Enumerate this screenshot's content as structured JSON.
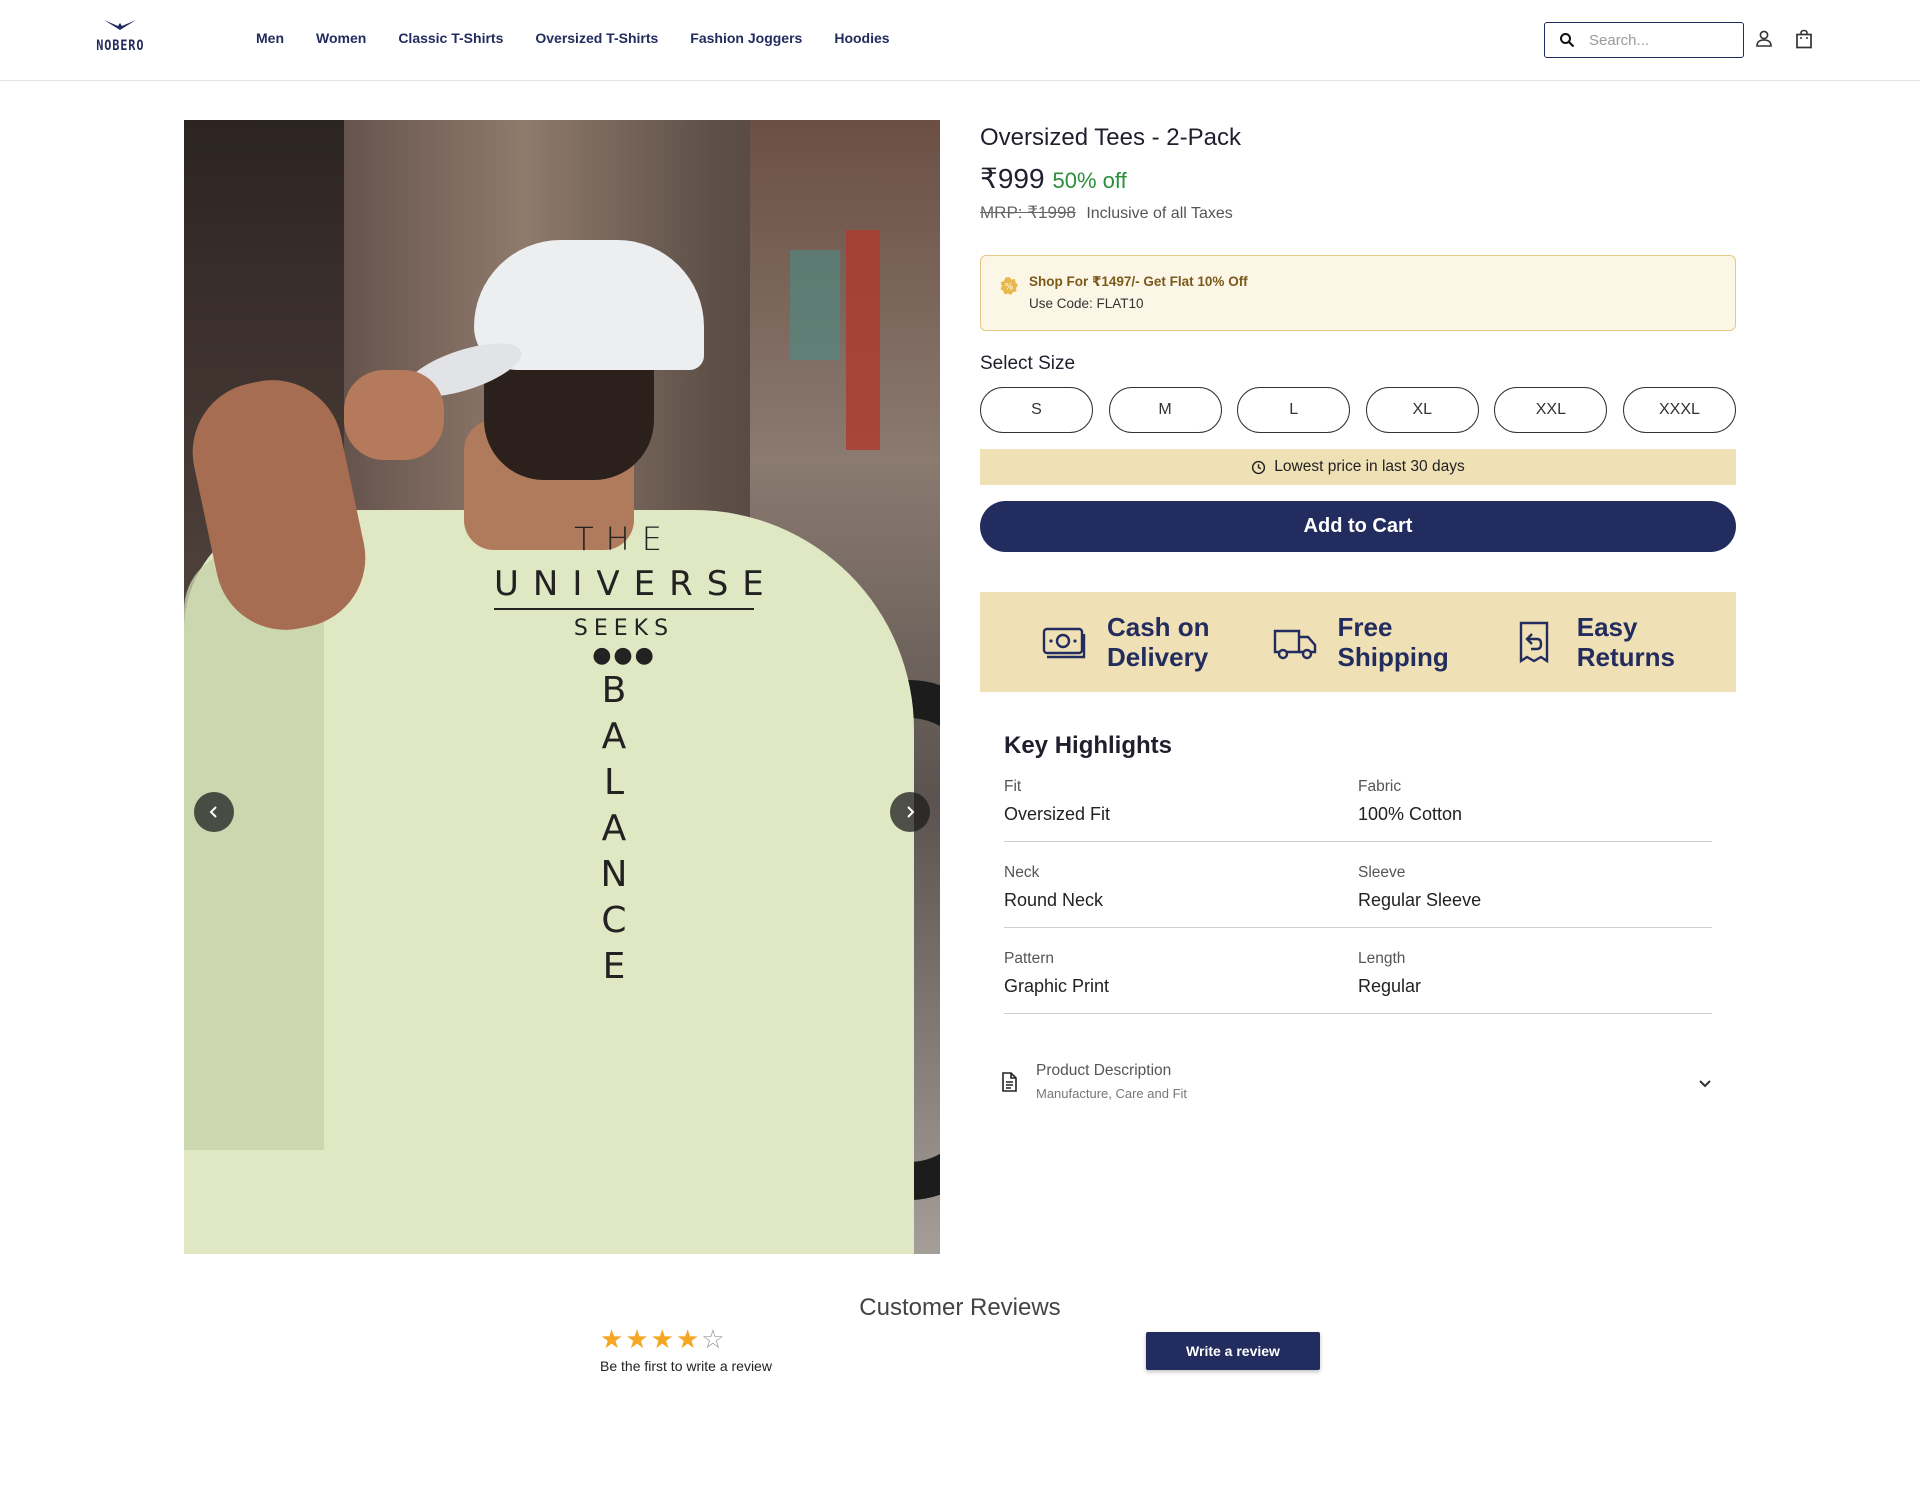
{
  "brand": {
    "logo_text": "NOBERO",
    "accent": "#232c5e",
    "highlight_bg": "#efe1b5"
  },
  "nav": {
    "items": [
      "Men",
      "Women",
      "Classic T-Shirts",
      "Oversized T-Shirts",
      "Fashion Joggers",
      "Hoodies"
    ]
  },
  "search": {
    "placeholder": "Search...",
    "icon": "search-icon"
  },
  "header_icons": [
    "account-icon",
    "shopping-bag-icon"
  ],
  "gallery": {
    "prev_icon": "chevron-left-icon",
    "next_icon": "chevron-right-icon"
  },
  "product": {
    "title": "Oversized Tees - 2-Pack",
    "price": "₹999",
    "discount": "50% off",
    "mrp": "MRP: ₹1998",
    "tax_note": "Inclusive of all Taxes",
    "discount_color": "#2a8f3b"
  },
  "offer": {
    "line1": "Shop For ₹1497/- Get Flat 10% Off",
    "line2": "Use Code: FLAT10",
    "icon": "discount-badge-icon"
  },
  "size": {
    "label": "Select Size",
    "options": [
      "S",
      "M",
      "L",
      "XL",
      "XXL",
      "XXXL"
    ]
  },
  "lowest_price": {
    "text": "Lowest price in last 30 days",
    "icon": "clock-icon"
  },
  "cart": {
    "label": "Add to Cart"
  },
  "perks": [
    {
      "line1": "Cash on",
      "line2": "Delivery",
      "icon": "cash-icon"
    },
    {
      "line1": "Free",
      "line2": "Shipping",
      "icon": "truck-icon"
    },
    {
      "line1": "Easy",
      "line2": "Returns",
      "icon": "return-receipt-icon"
    }
  ],
  "highlights": {
    "title": "Key Highlights",
    "rows": [
      [
        {
          "k": "Fit",
          "v": "Oversized Fit"
        },
        {
          "k": "Fabric",
          "v": "100% Cotton"
        }
      ],
      [
        {
          "k": "Neck",
          "v": "Round Neck"
        },
        {
          "k": "Sleeve",
          "v": "Regular Sleeve"
        }
      ],
      [
        {
          "k": "Pattern",
          "v": "Graphic Print"
        },
        {
          "k": "Length",
          "v": "Regular"
        }
      ]
    ]
  },
  "description": {
    "title": "Product Description",
    "subtitle": "Manufacture, Care and Fit",
    "icon": "document-icon"
  },
  "reviews": {
    "title": "Customer Reviews",
    "rating": 4,
    "max_rating": 5,
    "note": "Be the first to write a review",
    "button": "Write a review"
  },
  "print": {
    "l1": "THE",
    "l2": "UNIVERSE",
    "l3": "SEEKS",
    "vertical": [
      "B",
      "A",
      "L",
      "A",
      "N",
      "C",
      "E"
    ]
  }
}
